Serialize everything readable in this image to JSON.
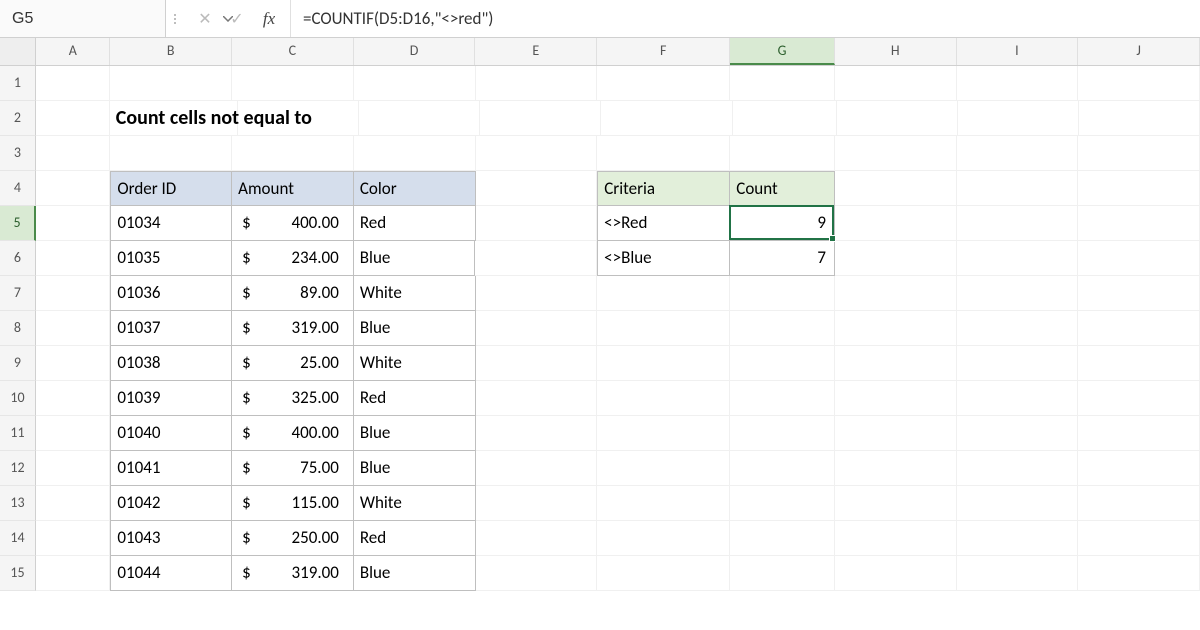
{
  "active_cell": "G5",
  "active_col": "G",
  "active_row": "5",
  "formula": "=COUNTIF(D5:D16,\"<>red\")",
  "columns": [
    "A",
    "B",
    "C",
    "D",
    "E",
    "F",
    "G",
    "H",
    "I",
    "J"
  ],
  "rows": [
    "1",
    "2",
    "3",
    "4",
    "5",
    "6",
    "7",
    "8",
    "9",
    "10",
    "11",
    "12",
    "13",
    "14",
    "15"
  ],
  "title": "Count cells not equal to",
  "table1": {
    "headers": [
      "Order ID",
      "Amount",
      "Color"
    ],
    "rows": [
      {
        "id": "01034",
        "amt": "400.00",
        "color": "Red"
      },
      {
        "id": "01035",
        "amt": "234.00",
        "color": "Blue"
      },
      {
        "id": "01036",
        "amt": "89.00",
        "color": "White"
      },
      {
        "id": "01037",
        "amt": "319.00",
        "color": "Blue"
      },
      {
        "id": "01038",
        "amt": "25.00",
        "color": "White"
      },
      {
        "id": "01039",
        "amt": "325.00",
        "color": "Red"
      },
      {
        "id": "01040",
        "amt": "400.00",
        "color": "Blue"
      },
      {
        "id": "01041",
        "amt": "75.00",
        "color": "Blue"
      },
      {
        "id": "01042",
        "amt": "115.00",
        "color": "White"
      },
      {
        "id": "01043",
        "amt": "250.00",
        "color": "Red"
      },
      {
        "id": "01044",
        "amt": "319.00",
        "color": "Blue"
      }
    ]
  },
  "table2": {
    "headers": [
      "Criteria",
      "Count"
    ],
    "rows": [
      {
        "crit": "<>Red",
        "count": "9"
      },
      {
        "crit": "<>Blue",
        "count": "7"
      }
    ]
  },
  "currency_symbol": "$",
  "icons": {
    "cancel": "✕",
    "enter": "✓",
    "fx": "fx"
  }
}
